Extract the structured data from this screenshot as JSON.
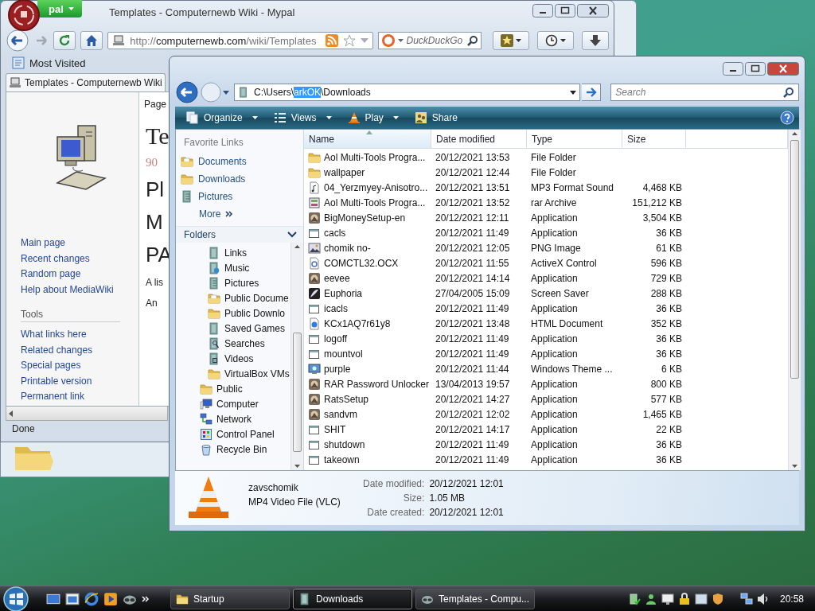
{
  "browser": {
    "app_menu": "pal",
    "title": "Templates - Computernewb Wiki - Mypal",
    "url": {
      "scheme": "http://",
      "host": "computernewb.com",
      "path": "/wiki/Templates"
    },
    "search_placeholder": "DuckDuckGo",
    "bookmarks": [
      "Most Visited"
    ],
    "tabs": [
      {
        "label": "Templates - Computernewb Wiki",
        "selected": true
      }
    ],
    "sidebar": {
      "navigation": [
        "Main page",
        "Recent changes",
        "Random page",
        "Help about MediaWiki"
      ],
      "tools_heading": "Tools",
      "tools": [
        "What links here",
        "Related changes",
        "Special pages",
        "Printable version",
        "Permanent link"
      ]
    },
    "content": {
      "page_tab": "Page",
      "title": "Te",
      "subtitle": "90",
      "headings": [
        "Pl",
        "M",
        "PA"
      ],
      "paragraphs": [
        "A lis",
        "An"
      ]
    },
    "status": "Done"
  },
  "explorer": {
    "address": {
      "before": "C:\\Users\\",
      "selected": "arkOK",
      "after": "\\Downloads"
    },
    "search_placeholder": "Search",
    "toolbar": [
      {
        "label": "Organize",
        "kind": "organize",
        "dropdown": true
      },
      {
        "label": "Views",
        "kind": "views",
        "dropdown": true
      },
      {
        "label": "Play",
        "kind": "play",
        "dropdown": true
      },
      {
        "label": "Share",
        "kind": "share",
        "dropdown": false
      }
    ],
    "favorites_heading": "Favorite Links",
    "favorites": [
      {
        "label": "Documents",
        "kind": "docs"
      },
      {
        "label": "Downloads",
        "kind": "folder"
      },
      {
        "label": "Pictures",
        "kind": "pictures"
      }
    ],
    "more": "More",
    "folders_heading": "Folders",
    "folders": [
      {
        "children": [
          {
            "label": "Links",
            "kind": "library"
          },
          {
            "label": "Music",
            "kind": "music"
          },
          {
            "label": "Pictures",
            "kind": "pictures"
          },
          {
            "label": "Public Docume",
            "kind": "docs"
          },
          {
            "label": "Public Downlo",
            "kind": "folder"
          },
          {
            "label": "Saved Games",
            "kind": "library"
          },
          {
            "label": "Searches",
            "kind": "searches"
          },
          {
            "label": "Videos",
            "kind": "videos"
          },
          {
            "label": "VirtualBox VMs",
            "kind": "folder"
          }
        ]
      },
      {
        "label": "Public",
        "kind": "folder"
      },
      {
        "label": "Computer",
        "kind": "computer"
      },
      {
        "label": "Network",
        "kind": "network"
      },
      {
        "label": "Control Panel",
        "kind": "control"
      },
      {
        "label": "Recycle Bin",
        "kind": "recycle"
      }
    ],
    "columns": [
      {
        "label": "Name",
        "sorted": true
      },
      {
        "label": "Date modified",
        "sorted": false
      },
      {
        "label": "Type",
        "sorted": false
      },
      {
        "label": "Size",
        "sorted": false
      }
    ],
    "rows": [
      {
        "name": "Aol Multi-Tools Progra...",
        "date": "20/12/2021 13:53",
        "type": "File Folder",
        "kind": "folder"
      },
      {
        "name": "wallpaper",
        "date": "20/12/2021 12:44",
        "type": "File Folder",
        "kind": "folder"
      },
      {
        "name": "04_Yerzmyey-Anisotro...",
        "date": "20/12/2021 13:51",
        "type": "MP3 Format Sound",
        "size": "4,468 KB",
        "kind": "audio"
      },
      {
        "name": "Aol Multi-Tools Progra...",
        "date": "20/12/2021 13:52",
        "type": "rar Archive",
        "size": "151,212 KB",
        "kind": "archive"
      },
      {
        "name": "BigMoneySetup-en",
        "date": "20/12/2021 12:11",
        "type": "Application",
        "size": "3,504 KB",
        "kind": "appart"
      },
      {
        "name": "cacls",
        "date": "20/12/2021 11:49",
        "type": "Application",
        "size": "36 KB",
        "kind": "app"
      },
      {
        "name": "chomik no-",
        "date": "20/12/2021 12:05",
        "type": "PNG Image",
        "size": "61 KB",
        "kind": "image"
      },
      {
        "name": "COMCTL32.OCX",
        "date": "20/12/2021 11:55",
        "type": "ActiveX Control",
        "size": "596 KB",
        "kind": "activex"
      },
      {
        "name": "eevee",
        "date": "20/12/2021 14:14",
        "type": "Application",
        "size": "729 KB",
        "kind": "appart"
      },
      {
        "name": "Euphoria",
        "date": "27/04/2005 15:09",
        "type": "Screen Saver",
        "size": "288 KB",
        "kind": "screensaver"
      },
      {
        "name": "icacls",
        "date": "20/12/2021 11:49",
        "type": "Application",
        "size": "36 KB",
        "kind": "app"
      },
      {
        "name": "KCx1AQ7r61y8",
        "date": "20/12/2021 13:48",
        "type": "HTML Document",
        "size": "352 KB",
        "kind": "html"
      },
      {
        "name": "logoff",
        "date": "20/12/2021 11:49",
        "type": "Application",
        "size": "36 KB",
        "kind": "app"
      },
      {
        "name": "mountvol",
        "date": "20/12/2021 11:49",
        "type": "Application",
        "size": "36 KB",
        "kind": "app"
      },
      {
        "name": "purple",
        "date": "20/12/2021 11:44",
        "type": "Windows Theme ...",
        "size": "6 KB",
        "kind": "theme"
      },
      {
        "name": "RAR Password Unlocker",
        "date": "13/04/2013 19:57",
        "type": "Application",
        "size": "800 KB",
        "kind": "appart"
      },
      {
        "name": "RatsSetup",
        "date": "20/12/2021 14:27",
        "type": "Application",
        "size": "577 KB",
        "kind": "appart"
      },
      {
        "name": "sandvm",
        "date": "20/12/2021 12:02",
        "type": "Application",
        "size": "1,465 KB",
        "kind": "appart"
      },
      {
        "name": "SHIT",
        "date": "20/12/2021 14:17",
        "type": "Application",
        "size": "22 KB",
        "kind": "app"
      },
      {
        "name": "shutdown",
        "date": "20/12/2021 11:49",
        "type": "Application",
        "size": "36 KB",
        "kind": "app"
      },
      {
        "name": "takeown",
        "date": "20/12/2021 11:49",
        "type": "Application",
        "size": "36 KB",
        "kind": "app"
      }
    ],
    "details": {
      "name": "zavschomik",
      "type": "MP4 Video File (VLC)",
      "fields": [
        {
          "label": "Date modified:",
          "value": "20/12/2021 12:01"
        },
        {
          "label": "Size:",
          "value": "1.05 MB"
        },
        {
          "label": "Date created:",
          "value": "20/12/2021 12:01"
        }
      ]
    }
  },
  "taskbar": {
    "tasks": [
      {
        "label": "Startup",
        "kind": "folder",
        "selected": false
      },
      {
        "label": "Downloads",
        "kind": "library",
        "selected": true
      },
      {
        "label": "Templates - Compu...",
        "kind": "browser",
        "selected": false
      }
    ],
    "clock": "20:58"
  }
}
